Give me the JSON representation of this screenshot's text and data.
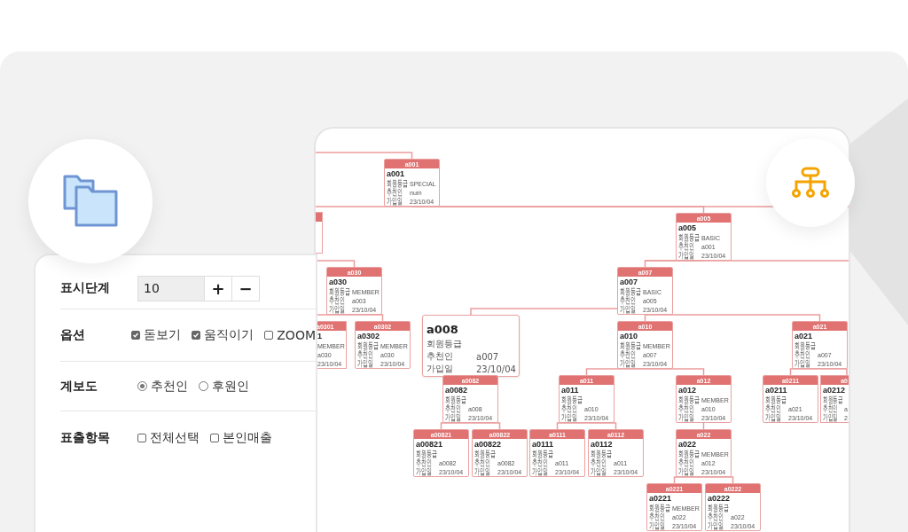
{
  "options_panel": {
    "rows": [
      {
        "label": "표시단계",
        "kind": "stepper",
        "value": "10",
        "buttons": [
          "+",
          "−"
        ]
      },
      {
        "label": "옵션",
        "kind": "checkboxes",
        "items": [
          {
            "label": "돋보기",
            "checked": true
          },
          {
            "label": "움직이기",
            "checked": true
          },
          {
            "label": "ZOOM",
            "checked": false
          }
        ]
      },
      {
        "label": "계보도",
        "kind": "radios",
        "items": [
          {
            "label": "추천인",
            "selected": true
          },
          {
            "label": "후원인",
            "selected": false
          }
        ]
      },
      {
        "label": "표출항목",
        "kind": "checkboxes",
        "items": [
          {
            "label": "전체선택",
            "checked": false
          },
          {
            "label": "본인매출",
            "checked": false
          }
        ]
      }
    ]
  },
  "org_chart": {
    "nodes": [
      {
        "kind": "card",
        "header": "a001",
        "title": "a001",
        "fields": [
          {
            "label": "회원등급",
            "value": "SPECIAL"
          },
          {
            "label": "추천인",
            "value": "num"
          },
          {
            "label": "가입일",
            "value": "23/10/04"
          }
        ],
        "children": [
          {
            "kind": "card",
            "header": "a005",
            "title": "a005",
            "fields": [
              {
                "label": "회원등급",
                "value": "BASIC"
              },
              {
                "label": "추천인",
                "value": "a001"
              },
              {
                "label": "가입일",
                "value": "23/10/04"
              }
            ],
            "children": [
              {
                "kind": "card",
                "header": "a007",
                "title": "a007",
                "fields": [
                  {
                    "label": "회원등급",
                    "value": "BASIC"
                  },
                  {
                    "label": "추천인",
                    "value": "a005"
                  },
                  {
                    "label": "가입일",
                    "value": "23/10/04"
                  }
                ],
                "children": [
                  {
                    "kind": "expanded",
                    "title": "a008",
                    "fields": [
                      {
                        "label": "회원등급"
                      },
                      {
                        "label": "추천인",
                        "value": "a007"
                      },
                      {
                        "label": "가입일",
                        "value": "23/10/04"
                      }
                    ],
                    "children": [
                      {
                        "kind": "card",
                        "header": "a0082",
                        "title": "a0082",
                        "fields": [
                          {
                            "label": "회원등급"
                          },
                          {
                            "label": "추천인",
                            "value": "a008"
                          },
                          {
                            "label": "가입일",
                            "value": "23/10/04"
                          }
                        ],
                        "children": [
                          {
                            "kind": "card",
                            "header": "a00821",
                            "title": "a00821",
                            "fields": [
                              {
                                "label": "회원등급"
                              },
                              {
                                "label": "추천인",
                                "value": "a0082"
                              },
                              {
                                "label": "가입일",
                                "value": "23/10/04"
                              }
                            ]
                          },
                          {
                            "kind": "card",
                            "header": "a00822",
                            "title": "a00822",
                            "fields": [
                              {
                                "label": "회원등급"
                              },
                              {
                                "label": "추천인",
                                "value": "a0082"
                              },
                              {
                                "label": "가입일",
                                "value": "23/10/04"
                              }
                            ]
                          }
                        ]
                      }
                    ]
                  },
                  {
                    "kind": "card",
                    "header": "a010",
                    "title": "a010",
                    "fields": [
                      {
                        "label": "회원등급",
                        "value": "MEMBER"
                      },
                      {
                        "label": "추천인",
                        "value": "a007"
                      },
                      {
                        "label": "가입일",
                        "value": "23/10/04"
                      }
                    ],
                    "children": [
                      {
                        "kind": "card",
                        "header": "a011",
                        "title": "a011",
                        "fields": [
                          {
                            "label": "회원등급"
                          },
                          {
                            "label": "추천인",
                            "value": "a010"
                          },
                          {
                            "label": "가입일",
                            "value": "23/10/04"
                          }
                        ],
                        "children": [
                          {
                            "kind": "card",
                            "header": "a0111",
                            "title": "a0111",
                            "fields": [
                              {
                                "label": "회원등급"
                              },
                              {
                                "label": "추천인",
                                "value": "a011"
                              },
                              {
                                "label": "가입일",
                                "value": "23/10/04"
                              }
                            ]
                          },
                          {
                            "kind": "card",
                            "header": "a0112",
                            "title": "a0112",
                            "fields": [
                              {
                                "label": "회원등급"
                              },
                              {
                                "label": "추천인",
                                "value": "a011"
                              },
                              {
                                "label": "가입일",
                                "value": "23/10/04"
                              }
                            ]
                          }
                        ]
                      },
                      {
                        "kind": "card",
                        "header": "a012",
                        "title": "a012",
                        "fields": [
                          {
                            "label": "회원등급",
                            "value": "MEMBER"
                          },
                          {
                            "label": "추천인",
                            "value": "a010"
                          },
                          {
                            "label": "가입일",
                            "value": "23/10/04"
                          }
                        ],
                        "children": [
                          {
                            "kind": "card",
                            "header": "a022",
                            "title": "a022",
                            "fields": [
                              {
                                "label": "회원등급",
                                "value": "MEMBER"
                              },
                              {
                                "label": "추천인",
                                "value": "a012"
                              },
                              {
                                "label": "가입일",
                                "value": "23/10/04"
                              }
                            ],
                            "children": [
                              {
                                "kind": "card",
                                "header": "a0221",
                                "title": "a0221",
                                "fields": [
                                  {
                                    "label": "회원등급",
                                    "value": "MEMBER"
                                  },
                                  {
                                    "label": "추천인",
                                    "value": "a022"
                                  },
                                  {
                                    "label": "가입일",
                                    "value": "23/10/04"
                                  }
                                ]
                              },
                              {
                                "kind": "card",
                                "header": "a0222",
                                "title": "a0222",
                                "fields": [
                                  {
                                    "label": "회원등급"
                                  },
                                  {
                                    "label": "추천인",
                                    "value": "a022"
                                  },
                                  {
                                    "label": "가입일",
                                    "value": "23/10/04"
                                  }
                                ]
                              }
                            ]
                          }
                        ]
                      }
                    ]
                  },
                  {
                    "kind": "card",
                    "header": "a021",
                    "title": "a021",
                    "fields": [
                      {
                        "label": "회원등급"
                      },
                      {
                        "label": "추천인",
                        "value": "a007"
                      },
                      {
                        "label": "가입일",
                        "value": "23/10/04"
                      }
                    ],
                    "children": [
                      {
                        "kind": "card",
                        "header": "a0211",
                        "title": "a0211",
                        "fields": [
                          {
                            "label": "회원등급"
                          },
                          {
                            "label": "추천인",
                            "value": "a021"
                          },
                          {
                            "label": "가입일",
                            "value": "23/10/04"
                          }
                        ]
                      },
                      {
                        "kind": "clipped-right",
                        "header": "a0",
                        "title": "a0212",
                        "fields": [
                          {
                            "label": "회원등급"
                          },
                          {
                            "label": "추천인",
                            "value": "a"
                          },
                          {
                            "label": "가입일",
                            "value": "2"
                          }
                        ]
                      }
                    ]
                  }
                ]
              }
            ]
          }
        ]
      },
      {
        "kind": "card",
        "header": "a030",
        "title": "a030",
        "fields": [
          {
            "label": "회원등급",
            "value": "MEMBER"
          },
          {
            "label": "추천인",
            "value": "a003"
          },
          {
            "label": "가입일",
            "value": "23/10/04"
          }
        ],
        "children": [
          {
            "kind": "clipped-left",
            "header": "a0301",
            "title": "1",
            "fields": [
              {
                "value": "MEMBER"
              },
              {
                "value": "a030"
              },
              {
                "value": "23/10/04"
              }
            ]
          },
          {
            "kind": "card",
            "header": "a0302",
            "title": "a0302",
            "fields": [
              {
                "label": "회원등급",
                "value": "MEMBER"
              },
              {
                "label": "추천인",
                "value": "a030"
              },
              {
                "label": "가입일",
                "value": "23/10/04"
              }
            ]
          }
        ]
      }
    ]
  }
}
